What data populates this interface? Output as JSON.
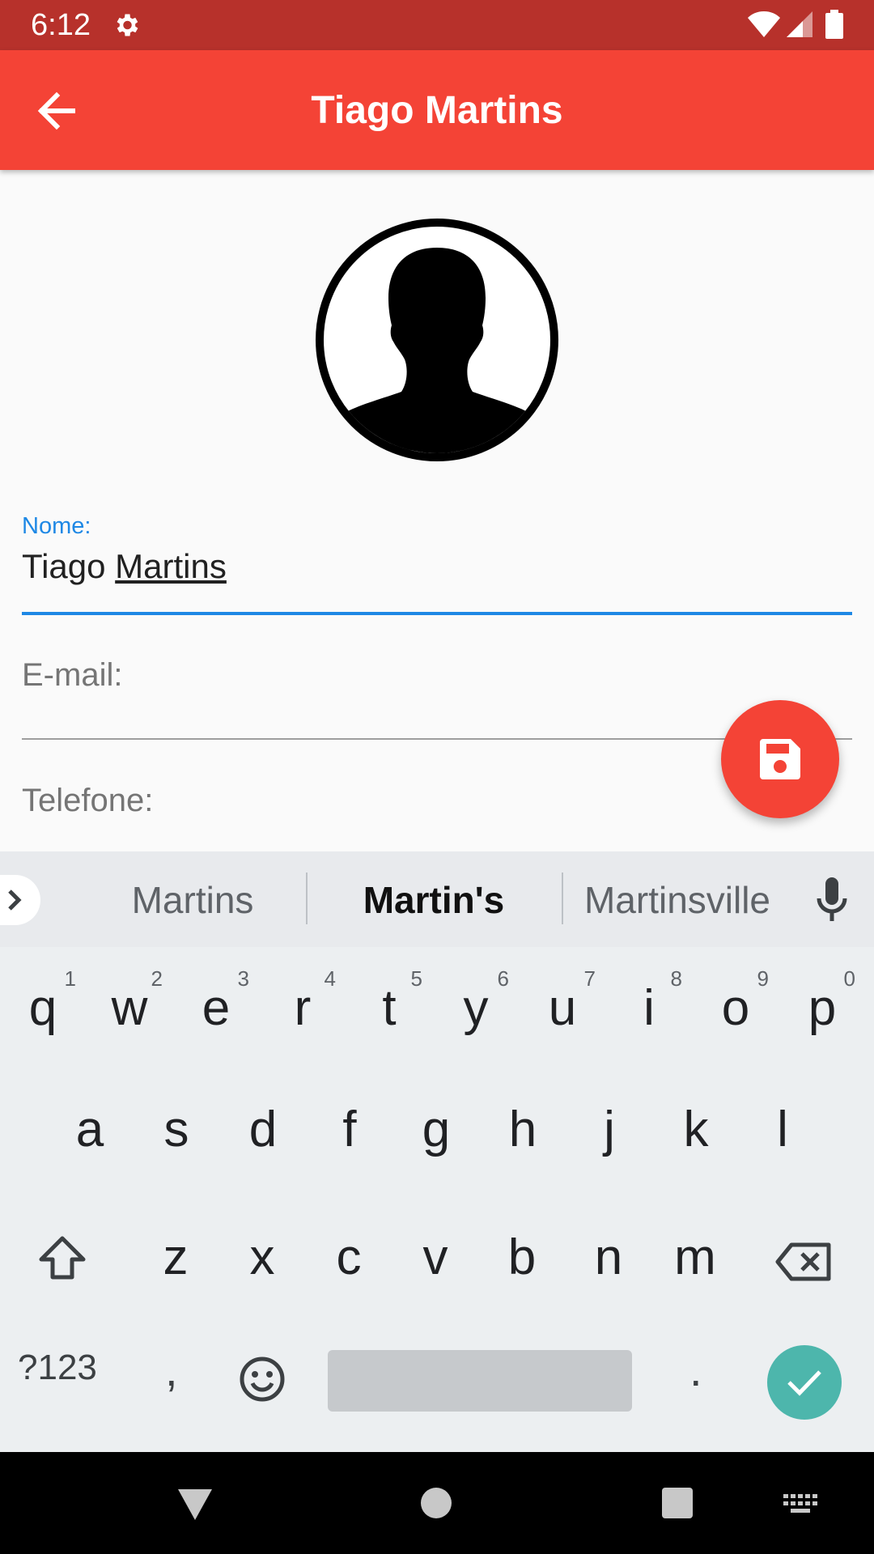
{
  "status_bar": {
    "time": "6:12"
  },
  "app_bar": {
    "title": "Tiago Martins"
  },
  "form": {
    "name_label": "Nome:",
    "name_value_first": "Tiago ",
    "name_value_last": "Martins",
    "email_label": "E-mail:",
    "phone_label": "Telefone:"
  },
  "keyboard": {
    "suggestions": [
      "Martins",
      "Martin's",
      "Martinsville"
    ],
    "row1": [
      {
        "key": "q",
        "hint": "1"
      },
      {
        "key": "w",
        "hint": "2"
      },
      {
        "key": "e",
        "hint": "3"
      },
      {
        "key": "r",
        "hint": "4"
      },
      {
        "key": "t",
        "hint": "5"
      },
      {
        "key": "y",
        "hint": "6"
      },
      {
        "key": "u",
        "hint": "7"
      },
      {
        "key": "i",
        "hint": "8"
      },
      {
        "key": "o",
        "hint": "9"
      },
      {
        "key": "p",
        "hint": "0"
      }
    ],
    "row2": [
      "a",
      "s",
      "d",
      "f",
      "g",
      "h",
      "j",
      "k",
      "l"
    ],
    "row3": [
      "z",
      "x",
      "c",
      "v",
      "b",
      "n",
      "m"
    ],
    "symbols_label": "?123",
    "comma": ",",
    "period": "."
  },
  "colors": {
    "status_bar": "#b7312b",
    "app_bar": "#f44336",
    "accent": "#1e88e5",
    "fab": "#f44336",
    "enter_key": "#4db6ac"
  },
  "icons": {
    "back": "arrow-left-icon",
    "save": "floppy-disk-icon",
    "avatar": "person-silhouette-icon",
    "settings": "gear-icon"
  }
}
